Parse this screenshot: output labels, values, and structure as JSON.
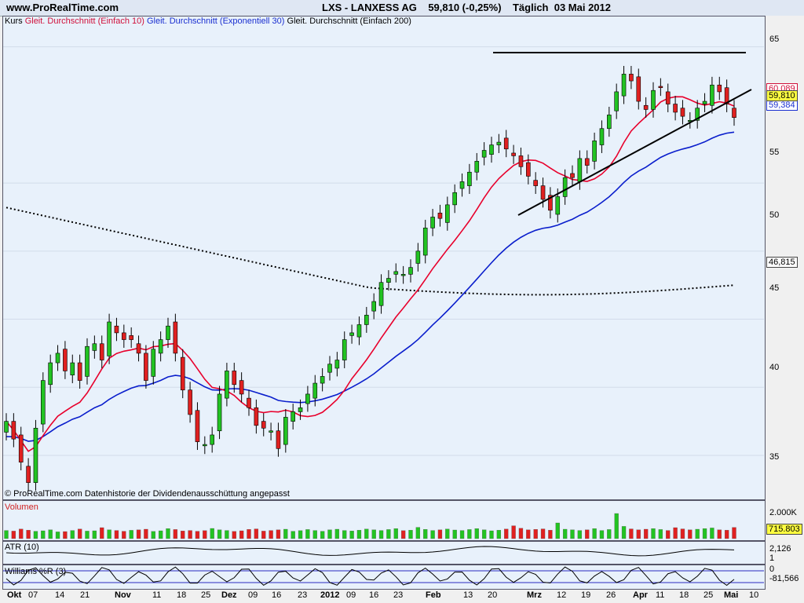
{
  "header": {
    "site": "www.ProRealTime.com",
    "ticker_line": "LXS - LANXESS AG    59,810 (-0,25%)    Täglich  03 Mai 2012"
  },
  "legend": {
    "kurs": "Kurs",
    "ma10": "Gleit. Durchschnitt (Einfach 10)",
    "ema30": "Gleit. Durchschnitt (Exponentiell 30)",
    "ma200": "Gleit. Durchschnitt (Einfach 200)"
  },
  "credit": "© ProRealTime.com  Datenhistorie der Dividendenausschüttung angepasst",
  "panels": {
    "volume": "Volumen",
    "atr": "ATR (10)",
    "williams": "Williams %R (3)"
  },
  "axis": {
    "y_ticks": [
      "65",
      "55",
      "50",
      "45",
      "40",
      "35"
    ],
    "price_tag": "59,810",
    "ma200_tag": "46,815",
    "ma10_tag": "60,089",
    "ema30_tag": "59,384",
    "vol_top": "2.000K",
    "vol_tag": "715.803",
    "atr_tag": "2,126",
    "atr_low": "1",
    "wr_top": "0",
    "wr_tag": "-81,566"
  },
  "colors": {
    "up": "#22c322",
    "down": "#e02020",
    "ma10": "#e8002c",
    "ema30": "#0a1ecc",
    "bg": "#e8f1fb"
  },
  "chart_data": {
    "type": "candlestick",
    "title": "LXS - LANXESS AG",
    "x_labels": [
      "Okt",
      "07",
      "14",
      "21",
      "Nov",
      "11",
      "18",
      "25",
      "Dez",
      "09",
      "16",
      "23",
      "2012",
      "09",
      "16",
      "23",
      "Feb",
      "13",
      "20",
      "Mrz",
      "12",
      "19",
      "26",
      "Apr",
      "11",
      "18",
      "25",
      "Mai",
      "10"
    ],
    "ylim": [
      32,
      67
    ],
    "close": [
      37.5,
      36.2,
      34.5,
      33.0,
      37.0,
      40.5,
      41.8,
      42.5,
      41.2,
      41.8,
      40.5,
      43.0,
      43.2,
      42.0,
      44.8,
      44.0,
      43.5,
      43.5,
      42.5,
      40.5,
      42.8,
      43.5,
      44.5,
      42.5,
      39.8,
      38.0,
      36.0,
      35.8,
      36.5,
      39.5,
      41.2,
      40.2,
      39.5,
      38.5,
      37.2,
      37.0,
      36.8,
      35.5,
      37.8,
      38.2,
      38.5,
      39.5,
      40.3,
      40.8,
      41.7,
      42.0,
      43.5,
      44.0,
      44.6,
      45.3,
      46.3,
      47.7,
      48.0,
      48.5,
      48.3,
      48.8,
      50.0,
      51.7,
      52.5,
      52.4,
      53.4,
      54.3,
      55.1,
      55.8,
      56.6,
      57.4,
      57.8,
      58.0,
      57.5,
      57.0,
      56.2,
      55.5,
      54.8,
      53.8,
      53.0,
      54.0,
      55.4,
      55.4,
      56.8,
      56.3,
      58.1,
      59.0,
      60.0,
      61.7,
      63.0,
      62.5,
      61.0,
      60.4,
      61.8,
      62.0,
      60.8,
      60.2,
      59.9,
      59.6,
      60.5,
      61.0,
      62.2,
      61.7,
      60.8,
      59.81
    ],
    "ma10": {
      "name": "Gleit. Durchschnitt (Einfach 10)",
      "last": 60.089
    },
    "ema30": {
      "name": "Gleit. Durchschnitt (Exponentiell 30)",
      "last": 59.384
    },
    "ma200": {
      "name": "Gleit. Durchschnitt (Einfach 200)",
      "last": 46.815
    },
    "volume": [
      520,
      480,
      610,
      540,
      470,
      500,
      560,
      430,
      450,
      520,
      610,
      480,
      500,
      700,
      560,
      520,
      470,
      530,
      560,
      600,
      460,
      500,
      640,
      580,
      490,
      520,
      470,
      510,
      650,
      560,
      520,
      460,
      500,
      590,
      620,
      480,
      520,
      560,
      600,
      470,
      510,
      580,
      520,
      470,
      560,
      600,
      520,
      490,
      540,
      610,
      560,
      520,
      580,
      640,
      510,
      540,
      720,
      590,
      520,
      560,
      610,
      550,
      520,
      580,
      640,
      560,
      500,
      540,
      610,
      820,
      660,
      560,
      590,
      620,
      540,
      1000,
      600,
      560,
      520,
      560,
      640,
      520,
      580,
      1600,
      780,
      620,
      560,
      600,
      640,
      580,
      520,
      700,
      620,
      560,
      600,
      640,
      680,
      560,
      540,
      715.803
    ]
  }
}
